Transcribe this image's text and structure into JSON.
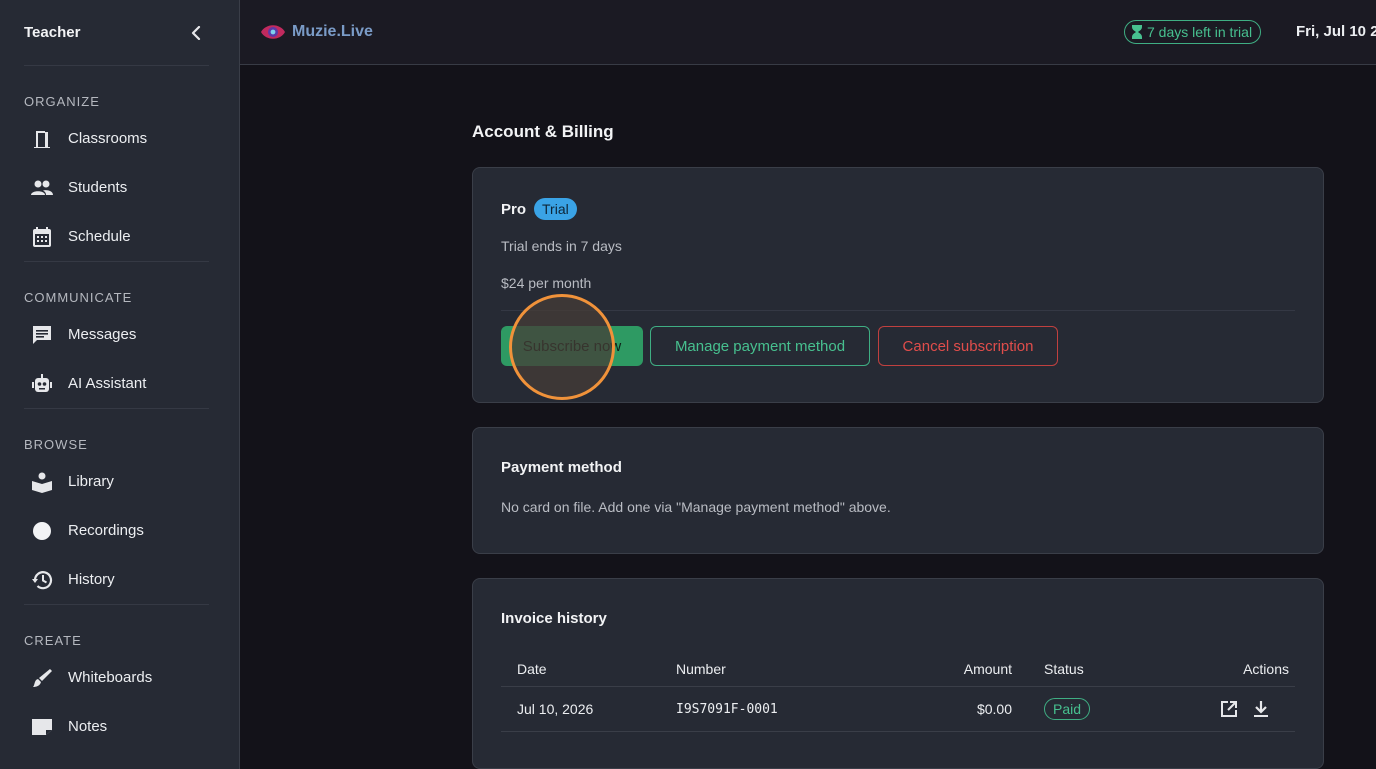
{
  "sidebar": {
    "title": "Teacher",
    "sections": [
      {
        "label": "ORGANIZE",
        "items": [
          {
            "label": "Classrooms",
            "icon": "door-icon"
          },
          {
            "label": "Students",
            "icon": "people-icon"
          },
          {
            "label": "Schedule",
            "icon": "calendar-icon"
          }
        ]
      },
      {
        "label": "COMMUNICATE",
        "items": [
          {
            "label": "Messages",
            "icon": "message-icon"
          },
          {
            "label": "AI Assistant",
            "icon": "robot-icon"
          }
        ]
      },
      {
        "label": "BROWSE",
        "items": [
          {
            "label": "Library",
            "icon": "reader-icon"
          },
          {
            "label": "Recordings",
            "icon": "record-icon"
          },
          {
            "label": "History",
            "icon": "history-icon"
          }
        ]
      },
      {
        "label": "CREATE",
        "items": [
          {
            "label": "Whiteboards",
            "icon": "brush-icon"
          },
          {
            "label": "Notes",
            "icon": "note-icon"
          }
        ]
      }
    ]
  },
  "topbar": {
    "brand": "Muzie.Live",
    "trial_pill": "7 days left in trial",
    "date": "Fri, Jul 10 2"
  },
  "main": {
    "page_title": "Account & Billing",
    "plan": {
      "name": "Pro",
      "badge": "Trial",
      "trial_text": "Trial ends in 7 days",
      "price_text": "$24 per month",
      "subscribe_label": "Subscribe now",
      "manage_label": "Manage payment method",
      "cancel_label": "Cancel subscription"
    },
    "payment": {
      "title": "Payment method",
      "text": "No card on file. Add one via \"Manage payment method\" above."
    },
    "invoices": {
      "title": "Invoice history",
      "headers": {
        "date": "Date",
        "number": "Number",
        "amount": "Amount",
        "status": "Status",
        "actions": "Actions"
      },
      "rows": [
        {
          "date": "Jul 10, 2026",
          "number": "I9S7091F-0001",
          "amount": "$0.00",
          "status": "Paid"
        }
      ]
    }
  },
  "colors": {
    "accent_green": "#47c08f",
    "danger_red": "#e04d4b",
    "trial_blue": "#3aa3e6",
    "cursor_orange": "#f0923a"
  }
}
